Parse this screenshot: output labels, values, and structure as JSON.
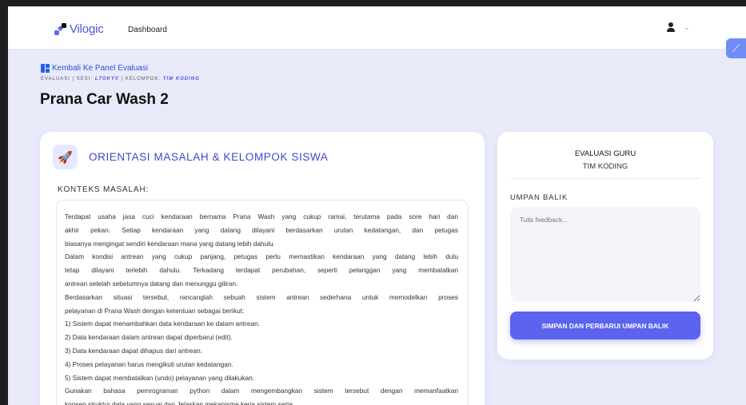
{
  "header": {
    "brand": "Vilogic",
    "nav_dashboard": "Dashboard",
    "user_icon": "user-icon",
    "chevron": "⌄",
    "side_badge_icon": "wand-icon",
    "side_badge_glyph": "⟋"
  },
  "breadcrumb": {
    "back_label": "Kembali Ke Panel Evaluasi",
    "eval_label": "EVALUASI | SESI:",
    "session": "L7OKYV",
    "group_label": "| KELOMPOK:",
    "group": "TIM KODING"
  },
  "page": {
    "title": "Prana Car Wash 2"
  },
  "section": {
    "icon": "rocket-icon",
    "icon_glyph": "🚀",
    "title": "ORIENTASI MASALAH & KELOMPOK SISWA",
    "konteks_label": "KONTEKS MASALAH:"
  },
  "context_lines": [
    "Terdapat usaha jasa cuci kendaraan bernama Prana Wash yang cukup ramai, terutama pada sore hari dan",
    "akhir pekan. Setiap kendaraan yang datang dilayani berdasarkan urutan kedatangan, dan petugas",
    "biasanya mengingat sendiri kendaraan mana yang datang lebih dahulu.",
    "Dalam kondisi antrean yang cukup panjang, petugas perlu memastikan kendaraan yang datang lebih dulu",
    "tetap dilayani terlebih dahulu. Terkadang terdapat perubahan, seperti pelanggan yang membatalkan",
    "antrean setelah sebelumnya datang dan menunggu giliran.",
    "Berdasarkan situasi tersebut, rancanglah sebuah sistem antrean sederhana untuk memodelkan proses",
    "pelayanan di Prana Wash dengan ketentuan sebagai berikut:",
    "1) Sistem dapat menambahkan data kendaraan ke dalam antrean.",
    "2) Data kendaraan dalam antrean dapat diperbarui (edit).",
    "3) Data kendaraan dapat dihapus dari antrean.",
    "4) Proses pelayanan harus mengikuti urutan kedatangan.",
    "5) Sistem dapat membatalkan (undo) pelayanan yang dilakukan.",
    "Gunakan bahasa pemrograman python dalam mengembangkan sistem tersebut dengan memanfaatkan",
    "konsep struktur data yang sesuai dan Jelaskan mekanisme kerja sistem serta"
  ],
  "evaluation": {
    "title": "EVALUASI GURU",
    "group": "TIM KODING",
    "feedback_label": "UMPAN BALIK",
    "feedback_placeholder": "Tulis feedback...",
    "feedback_value": "",
    "save_label": "SIMPAN DAN PERBARUI UMPAN BALIK"
  },
  "colors": {
    "accent": "#5b63ef",
    "brand": "#4b55d6",
    "page_bg": "#e9ebfb"
  }
}
